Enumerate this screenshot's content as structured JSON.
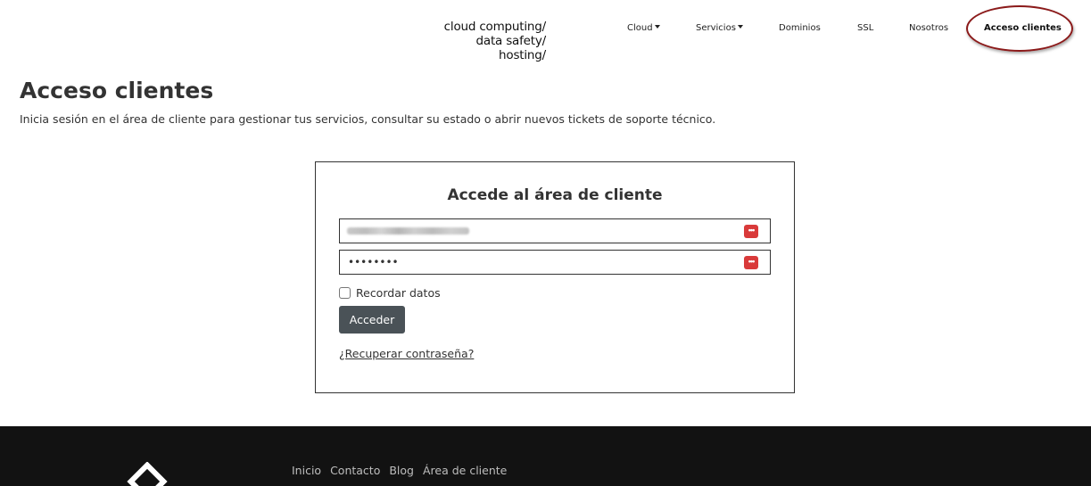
{
  "header": {
    "tagline": [
      "cloud computing/",
      "data safety/",
      "hosting/"
    ],
    "nav": [
      {
        "label": "Cloud",
        "dropdown": true
      },
      {
        "label": "Servicios",
        "dropdown": true
      },
      {
        "label": "Dominios",
        "dropdown": false
      },
      {
        "label": "SSL",
        "dropdown": false
      },
      {
        "label": "Nosotros",
        "dropdown": false
      },
      {
        "label": "Acceso clientes",
        "dropdown": false,
        "active": true
      }
    ],
    "highlight_color": "#8b1a1a"
  },
  "page": {
    "title": "Acceso clientes",
    "description": "Inicia sesión en el área de cliente para gestionar tus servicios, consultar su estado o abrir nuevos tickets de soporte técnico."
  },
  "login": {
    "title": "Accede al área de cliente",
    "email_value": "",
    "password_value": "••••••••",
    "field_icon": "password-manager-icon",
    "remember_label": "Recordar datos",
    "submit_label": "Acceder",
    "recover_label": "¿Recuperar contraseña?"
  },
  "footer": {
    "logo": "diamond-logo-icon",
    "links": [
      "Inicio",
      "Contacto",
      "Blog",
      "Área de cliente"
    ]
  },
  "colors": {
    "button_bg": "#4a5257",
    "footer_bg": "#121212",
    "icon_red": "#d93a3a"
  }
}
